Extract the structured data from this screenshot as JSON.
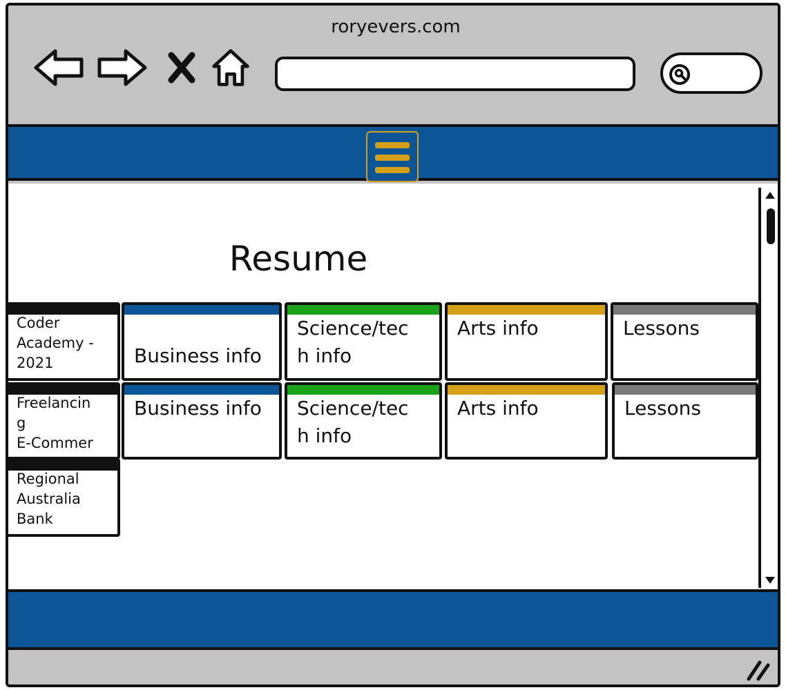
{
  "browser": {
    "title": "roryevers.com",
    "url": "",
    "icons": [
      "back-arrow-icon",
      "forward-arrow-icon",
      "close-x-icon",
      "home-icon",
      "search-icon"
    ]
  },
  "nav": {
    "menu_icon": "hamburger-icon",
    "menu_color": "#d4a017",
    "bar_color": "#0c5596"
  },
  "page": {
    "title": "Resume"
  },
  "rows": [
    {
      "label": "Coder\nAcademy -\n2021",
      "cards": [
        {
          "label": "Business info",
          "color": "#0c5596"
        },
        {
          "label": "Science/tec\nh info",
          "color": "#1aa31a"
        },
        {
          "label": "Arts info",
          "color": "#d4a017"
        },
        {
          "label": "Lessons",
          "color": "#7a7a7a"
        }
      ]
    },
    {
      "label": "Freelancin\ng\nE-Commer",
      "cards": [
        {
          "label": "Business info",
          "color": "#0c5596"
        },
        {
          "label": "Science/tec\nh info",
          "color": "#1aa31a"
        },
        {
          "label": "Arts info",
          "color": "#d4a017"
        },
        {
          "label": "Lessons",
          "color": "#7a7a7a"
        }
      ]
    },
    {
      "label": "Regional\nAustralia\nBank",
      "cards": []
    }
  ]
}
